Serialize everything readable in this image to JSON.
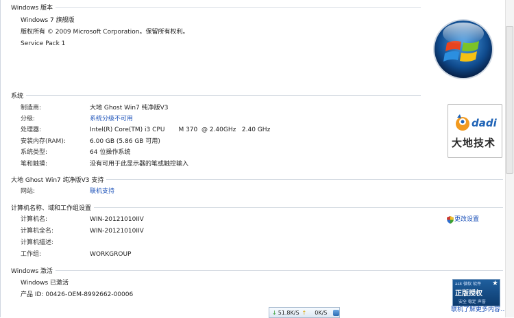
{
  "edition": {
    "header": "Windows 版本",
    "name": "Windows 7 旗舰版",
    "copyright": "版权所有 © 2009 Microsoft Corporation。保留所有权利。",
    "service_pack": "Service Pack 1"
  },
  "system": {
    "header": "系统",
    "rows": [
      {
        "label": "制造商:",
        "value": "大地 Ghost Win7 纯净版V3"
      },
      {
        "label": "分级:",
        "value": "系统分级不可用"
      },
      {
        "label": "处理器:",
        "value": "Intel(R) Core(TM) i3 CPU       M 370  @ 2.40GHz   2.40 GHz"
      },
      {
        "label": "安装内存(RAM):",
        "value": "6.00 GB (5.86 GB 可用)"
      },
      {
        "label": "系统类型:",
        "value": "64 位操作系统"
      },
      {
        "label": "笔和触摸:",
        "value": "没有可用于此显示器的笔或触控输入"
      }
    ]
  },
  "support": {
    "header": "大地 Ghost Win7 纯净版V3 支持",
    "website_label": "网站:",
    "website_link": "联机支持"
  },
  "computer": {
    "header": "计算机名称、域和工作组设置",
    "rows": [
      {
        "label": "计算机名:",
        "value": "WIN-20121010IIV"
      },
      {
        "label": "计算机全名:",
        "value": "WIN-20121010IIV"
      },
      {
        "label": "计算机描述:",
        "value": ""
      },
      {
        "label": "工作组:",
        "value": "WORKGROUP"
      }
    ],
    "change_settings": "更改设置"
  },
  "activation": {
    "header": "Windows 激活",
    "status": "Windows 已激活",
    "product_id": "产品 ID: 00426-OEM-8992662-00006",
    "learn_more": "联机了解更多内容..."
  },
  "logos": {
    "dadi_word": "dadi",
    "dadi_cn": "大地技术",
    "genuine_top": "ask 微软 软件",
    "genuine_main": "正版授权",
    "genuine_bottom": "安全 稳定 声誉"
  },
  "speed": {
    "down": "51.8K/S",
    "up": "0K/S"
  },
  "colors": {
    "link": "#1c52b9",
    "section_line": "#d6dce3",
    "genuine_bg": "#1f5f9e"
  },
  "icons": {
    "windows_logo": "windows-orb-icon",
    "shield": "uac-shield-icon",
    "down_arrow": "arrow-down-icon",
    "up_arrow": "arrow-up-icon"
  }
}
